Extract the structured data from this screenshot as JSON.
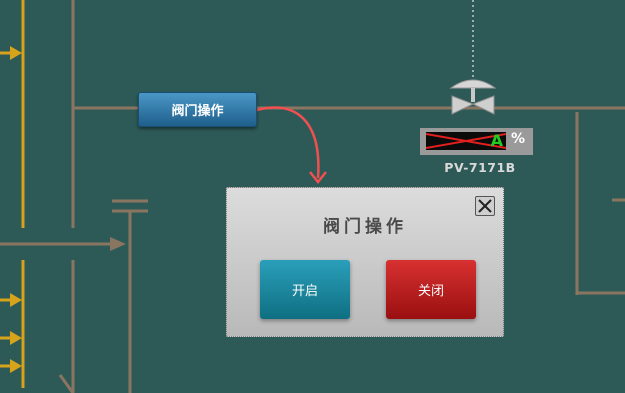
{
  "valve_operation_button": {
    "label": "阀门操作"
  },
  "valve_readout": {
    "value": "A",
    "unit": "%"
  },
  "valve_tag": "PV-7171B",
  "dialog": {
    "title": "阀门操作",
    "open_label": "开启",
    "close_label": "关闭"
  },
  "colors": {
    "background": "#2d5a57",
    "pipe": "#8a7560",
    "yellow_pipe": "#d7a31a",
    "arrow": "#f05050",
    "open_button": "#1f8ba3",
    "close_button": "#c11f20"
  }
}
